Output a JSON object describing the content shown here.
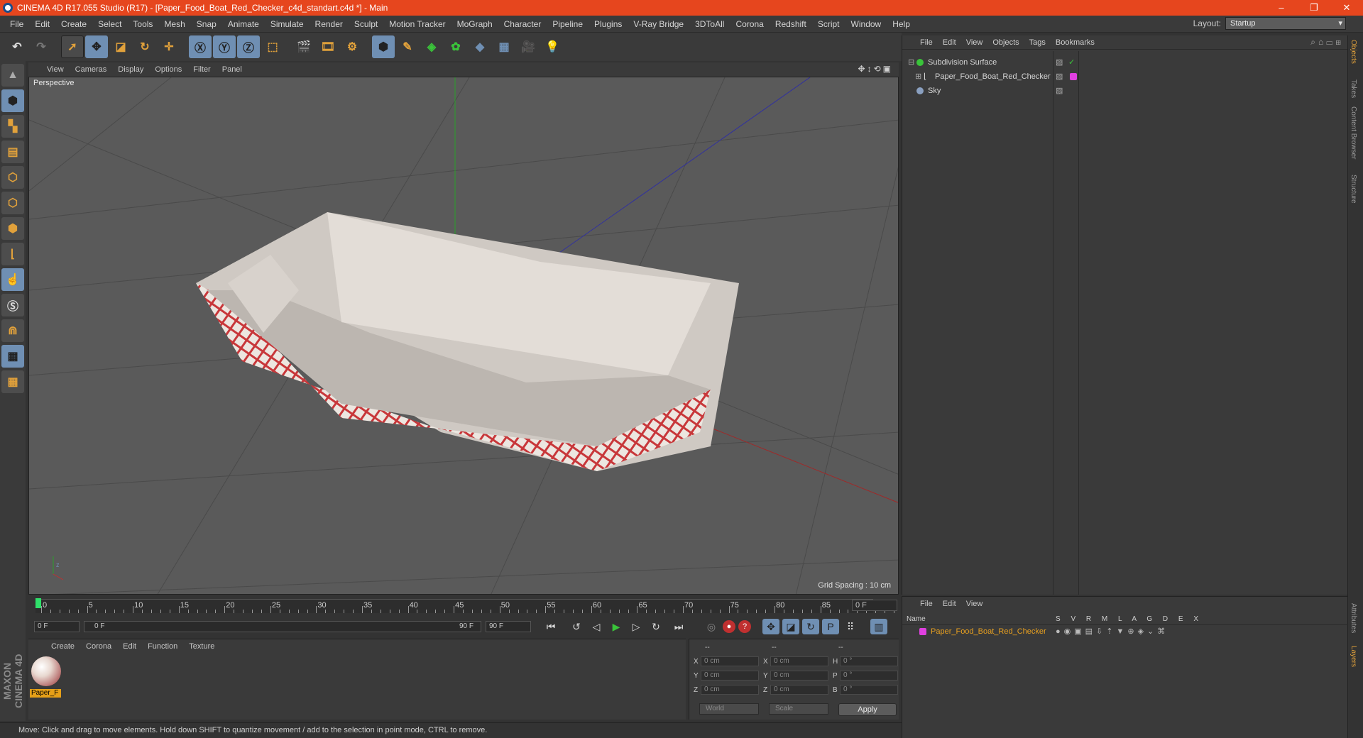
{
  "titlebar": {
    "title": "CINEMA 4D R17.055 Studio (R17) - [Paper_Food_Boat_Red_Checker_c4d_standart.c4d *] - Main",
    "min": "–",
    "restore": "❐",
    "close": "✕"
  },
  "menubar": {
    "items": [
      "File",
      "Edit",
      "Create",
      "Select",
      "Tools",
      "Mesh",
      "Snap",
      "Animate",
      "Simulate",
      "Render",
      "Sculpt",
      "Motion Tracker",
      "MoGraph",
      "Character",
      "Pipeline",
      "Plugins",
      "V-Ray Bridge",
      "3DToAll",
      "Corona",
      "Redshift",
      "Script",
      "Window",
      "Help"
    ],
    "layout_label": "Layout:",
    "layout_value": "Startup"
  },
  "viewport": {
    "menu": [
      "View",
      "Cameras",
      "Display",
      "Options",
      "Filter",
      "Panel"
    ],
    "label": "Perspective",
    "grid_spacing": "Grid Spacing : 10 cm"
  },
  "timeline": {
    "ticks": [
      "0",
      "5",
      "10",
      "15",
      "20",
      "25",
      "30",
      "35",
      "40",
      "45",
      "50",
      "55",
      "60",
      "65",
      "70",
      "75",
      "80",
      "85",
      "90"
    ],
    "current_frame": "0 F",
    "start": "0 F",
    "range_start": "0 F",
    "range_end": "90 F",
    "end": "90 F"
  },
  "material": {
    "menu": [
      "Create",
      "Corona",
      "Edit",
      "Function",
      "Texture"
    ],
    "name": "Paper_F"
  },
  "coords": {
    "headers": [
      "--",
      "--",
      "--"
    ],
    "rows": [
      {
        "l1": "X",
        "v1": "0 cm",
        "l2": "X",
        "v2": "0 cm",
        "l3": "H",
        "v3": "0 °"
      },
      {
        "l1": "Y",
        "v1": "0 cm",
        "l2": "Y",
        "v2": "0 cm",
        "l3": "P",
        "v3": "0 °"
      },
      {
        "l1": "Z",
        "v1": "0 cm",
        "l2": "Z",
        "v2": "0 cm",
        "l3": "B",
        "v3": "0 °"
      }
    ],
    "world": "World",
    "scale": "Scale",
    "apply": "Apply"
  },
  "status": "Move: Click and drag to move elements. Hold down SHIFT to quantize movement / add to the selection in point mode, CTRL to remove.",
  "objects": {
    "menu": [
      "File",
      "Edit",
      "View",
      "Objects",
      "Tags",
      "Bookmarks"
    ],
    "items": [
      {
        "name": "Subdivision Surface",
        "color": "#3ac43a"
      },
      {
        "name": "Paper_Food_Boat_Red_Checker",
        "color": "#e040e0"
      },
      {
        "name": "Sky",
        "color": "#8aa0c0"
      }
    ]
  },
  "right_tabs": [
    "Objects",
    "Takes",
    "Content Browser",
    "Structure"
  ],
  "right_tabs_bottom": [
    "Attributes",
    "Layers"
  ],
  "layers": {
    "menu": [
      "File",
      "Edit",
      "View"
    ],
    "header": {
      "name": "Name",
      "cols": "S V R M L A G D E X"
    },
    "row": {
      "name": "Paper_Food_Boat_Red_Checker",
      "color": "#e040e0"
    }
  },
  "brand": {
    "logo": "MAXON CINEMA 4D",
    "accent": "#e6461e",
    "highlight": "#6f8fb3"
  }
}
